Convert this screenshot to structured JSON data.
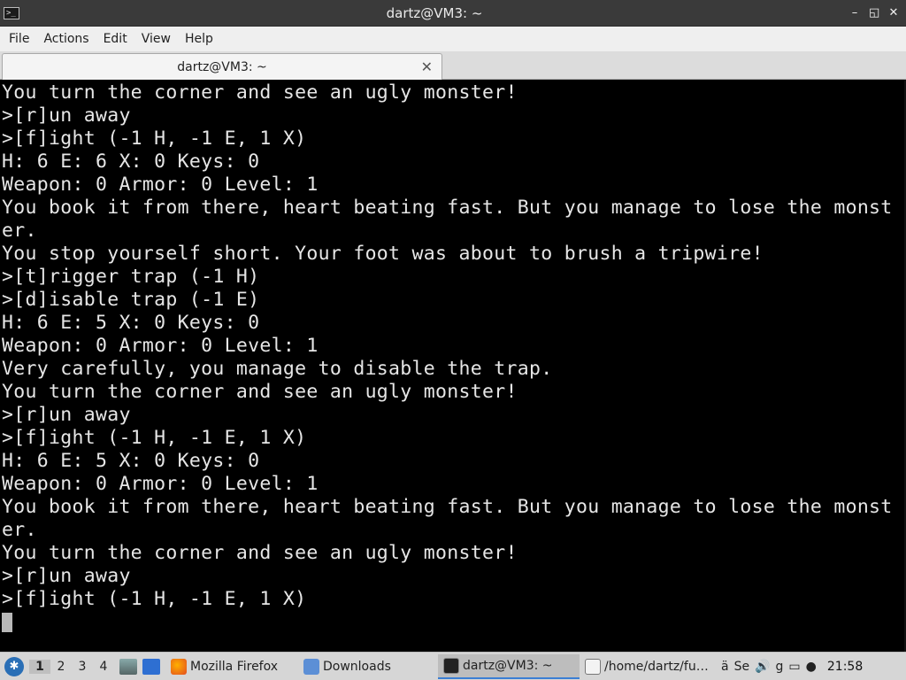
{
  "window": {
    "title": "dartz@VM3: ~",
    "controls": [
      "–",
      "◱",
      "✕"
    ]
  },
  "menu": [
    "File",
    "Actions",
    "Edit",
    "View",
    "Help"
  ],
  "tab": {
    "label": "dartz@VM3: ~"
  },
  "terminal": {
    "lines": [
      "You turn the corner and see an ugly monster!",
      ">[r]un away",
      ">[f]ight (-1 H, -1 E, 1 X)",
      "H: 6 E: 6 X: 0 Keys: 0",
      "Weapon: 0 Armor: 0 Level: 1",
      "You book it from there, heart beating fast. But you manage to lose the monst",
      "er.",
      "You stop yourself short. Your foot was about to brush a tripwire!",
      ">[t]rigger trap (-1 H)",
      ">[d]isable trap (-1 E)",
      "H: 6 E: 5 X: 0 Keys: 0",
      "Weapon: 0 Armor: 0 Level: 1",
      "Very carefully, you manage to disable the trap.",
      "You turn the corner and see an ugly monster!",
      ">[r]un away",
      ">[f]ight (-1 H, -1 E, 1 X)",
      "H: 6 E: 5 X: 0 Keys: 0",
      "Weapon: 0 Armor: 0 Level: 1",
      "You book it from there, heart beating fast. But you manage to lose the monst",
      "er.",
      "You turn the corner and see an ugly monster!",
      ">[r]un away",
      ">[f]ight (-1 H, -1 E, 1 X)"
    ]
  },
  "taskbar": {
    "workspaces": [
      "1",
      "2",
      "3",
      "4"
    ],
    "active_workspace": "1",
    "tasks": [
      {
        "label": "Mozilla Firefox",
        "icon": "firefox-icon"
      },
      {
        "label": "Downloads",
        "icon": "folder-icon"
      },
      {
        "label": "dartz@VM3: ~",
        "icon": "terminal-icon"
      },
      {
        "label": "/home/dartz/fu…",
        "icon": "text-editor-icon"
      }
    ],
    "tray_text": [
      "ä",
      "Se",
      "g"
    ],
    "clock": "21:58"
  }
}
